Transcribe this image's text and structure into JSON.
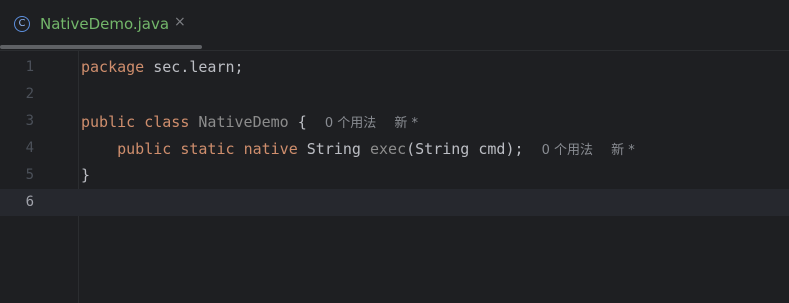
{
  "tab": {
    "icon_glyph": "C",
    "label": "NativeDemo.java",
    "close_glyph": "×"
  },
  "colors": {
    "background": "#1e1f22",
    "keyword": "#cf8e6d",
    "tab_label": "#73b66a",
    "text": "#bcbec4",
    "gray": "#8c8c8c"
  },
  "editor": {
    "current_line": 6,
    "lines": [
      {
        "number": "1",
        "kw1": "package",
        "text": " sec.learn;"
      },
      {
        "number": "2"
      },
      {
        "number": "3",
        "kw1": "public",
        "kw2": "class",
        "decl": "NativeDemo",
        "punct": " {",
        "hint_usages": "0 个用法",
        "hint_new": "新 *"
      },
      {
        "number": "4",
        "kw1": "public",
        "kw2": "static",
        "kw3": "native",
        "type": "String",
        "decl": "exec",
        "params": "(String cmd);",
        "hint_usages": "0 个用法",
        "hint_new": "新 *"
      },
      {
        "number": "5",
        "text": "}"
      },
      {
        "number": "6"
      }
    ]
  }
}
